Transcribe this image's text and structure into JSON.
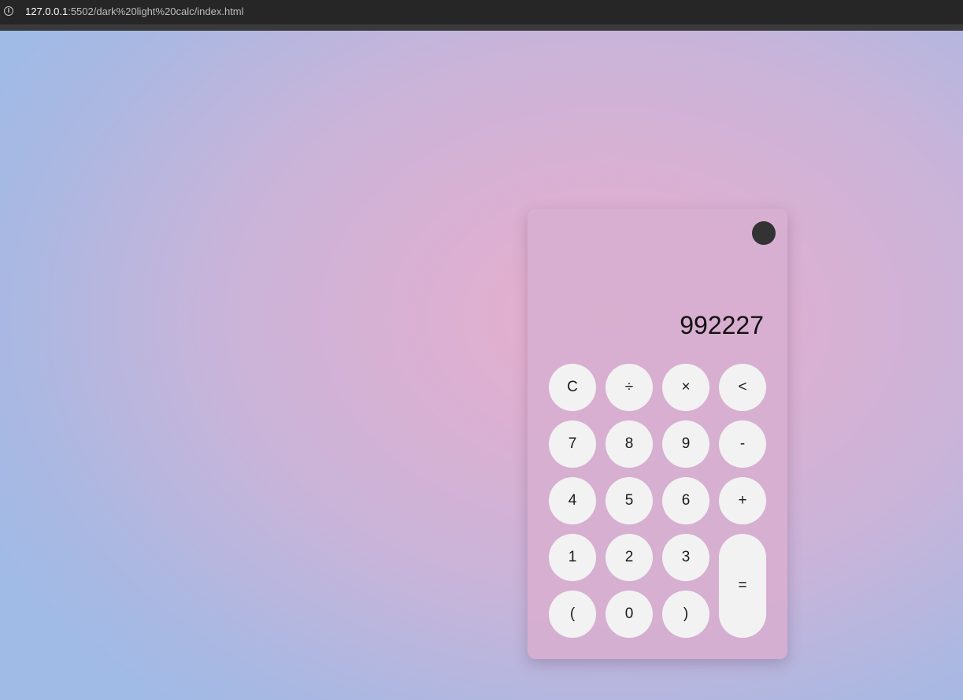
{
  "browser": {
    "url_host": "127.0.0.1",
    "url_rest": ":5502/dark%20light%20calc/index.html",
    "info_icon": "info-icon"
  },
  "calculator": {
    "display_value": "992227",
    "theme_toggle_icon": "dark-mode-toggle",
    "keys": {
      "clear": "C",
      "divide": "÷",
      "multiply": "×",
      "backspace": "<",
      "seven": "7",
      "eight": "8",
      "nine": "9",
      "minus": "-",
      "four": "4",
      "five": "5",
      "six": "6",
      "plus": "+",
      "one": "1",
      "two": "2",
      "three": "3",
      "equals": "=",
      "open_paren": "(",
      "zero": "0",
      "close_paren": ")"
    }
  },
  "colors": {
    "toggle": "#333333",
    "key_bg": "#f2f2f2",
    "card_bg": "#d7afd0"
  }
}
